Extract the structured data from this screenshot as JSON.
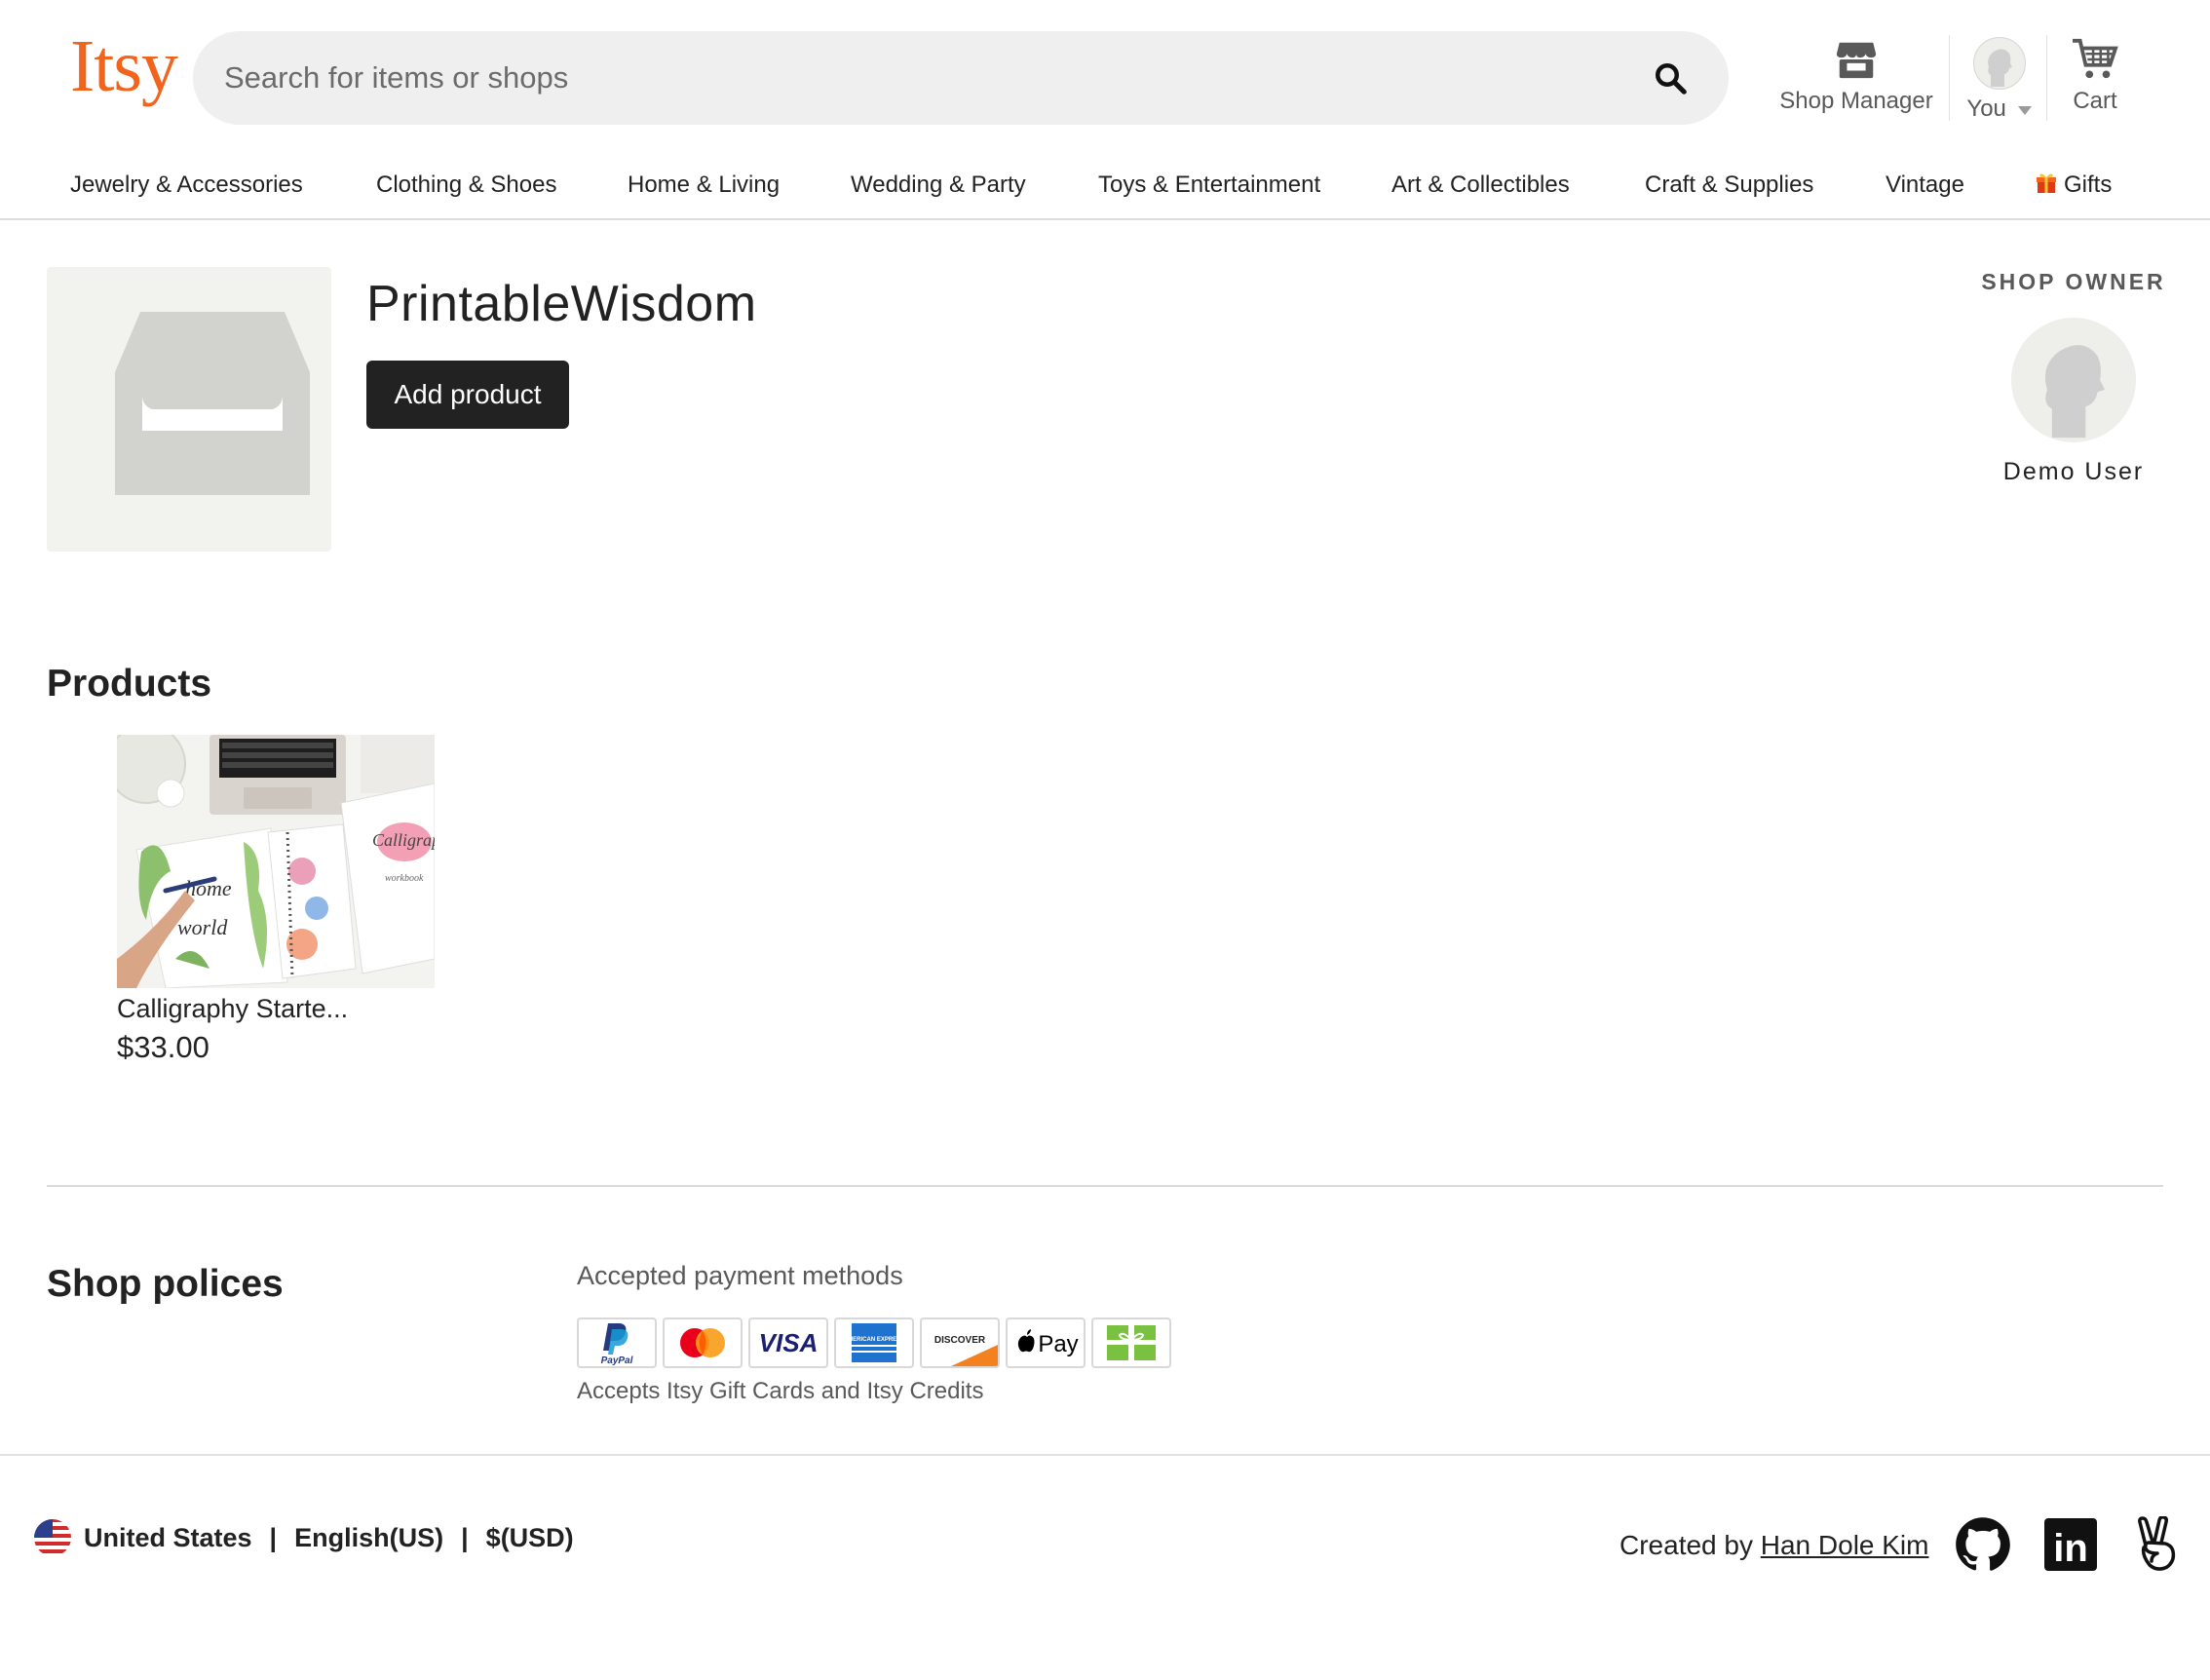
{
  "header": {
    "logo": "Itsy",
    "search_placeholder": "Search for items or shops",
    "shop_manager_label": "Shop Manager",
    "you_label": "You",
    "cart_label": "Cart"
  },
  "nav": {
    "items": [
      "Jewelry & Accessories",
      "Clothing & Shoes",
      "Home & Living",
      "Wedding & Party",
      "Toys & Entertainment",
      "Art & Collectibles",
      "Craft & Supplies",
      "Vintage",
      "Gifts"
    ]
  },
  "shop": {
    "name": "PrintableWisdom",
    "add_product_label": "Add product",
    "owner_title": "SHOP OWNER",
    "owner_name": "Demo User"
  },
  "products": {
    "title": "Products",
    "items": [
      {
        "title": "Calligraphy Starte...",
        "price": "$33.00"
      }
    ]
  },
  "policies": {
    "title": "Shop polices",
    "payment_heading": "Accepted payment methods",
    "payment_methods": [
      "paypal-icon",
      "mastercard-icon",
      "visa-icon",
      "amex-icon",
      "discover-icon",
      "apple-pay-icon",
      "gift-card-icon"
    ],
    "payment_labels": {
      "paypal": "PayPal",
      "visa": "VISA",
      "amex": "AMERICAN EXPRESS",
      "discover": "DISCOVER",
      "apple_pay": "Pay"
    },
    "gift_note": "Accepts Itsy Gift Cards and Itsy Credits"
  },
  "footer": {
    "country": "United States",
    "language": "English(US)",
    "currency": "$(USD)",
    "separator": "|",
    "created_by": "Created by",
    "author": "Han Dole Kim",
    "linkedin_text": "in"
  },
  "colors": {
    "brand": "#f1641e",
    "button_dark": "#222222",
    "search_bg": "#efefef"
  }
}
